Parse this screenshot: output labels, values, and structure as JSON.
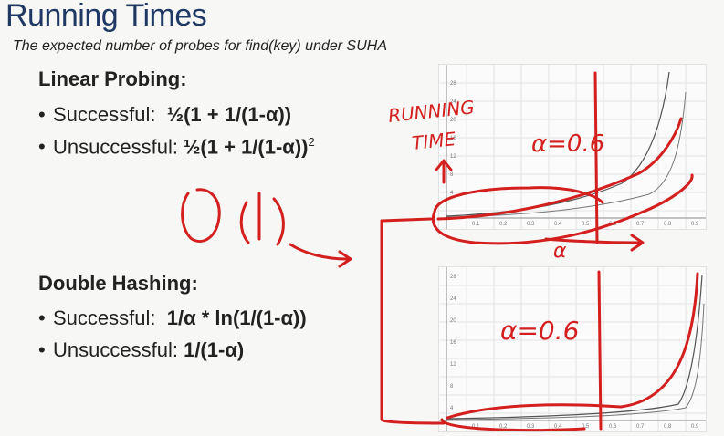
{
  "slide": {
    "title": "Running Times",
    "subtitle": "The expected number of probes for find(key) under SUHA"
  },
  "linear_probing": {
    "heading": "Linear Probing:",
    "successful_label": "Successful:",
    "successful_formula": "½(1 + 1/(1-α))",
    "unsuccessful_label": "Unsuccessful:",
    "unsuccessful_formula": "½(1 + 1/(1-α))",
    "unsuccessful_power": "2"
  },
  "double_hashing": {
    "heading": "Double Hashing:",
    "successful_label": "Successful:",
    "successful_formula": "1/α * ln(1/(1-α))",
    "unsuccessful_label": "Unsuccessful:",
    "unsuccessful_formula": "1/(1-α)"
  },
  "annotations": {
    "big_o": "O(1)",
    "running_time_line1": "RUNNING",
    "running_time_line2": "TIME",
    "alpha_top": "α=0.6",
    "alpha_axis": "α",
    "alpha_bottom": "α=0.6"
  },
  "graph_top": {
    "y_ticks": [
      "28",
      "24",
      "20",
      "16",
      "12",
      "8",
      "4"
    ],
    "x_ticks": [
      "0.1",
      "0.2",
      "0.3",
      "0.4",
      "0.5",
      "0.6",
      "0.7",
      "0.8",
      "0.9"
    ]
  },
  "graph_bottom": {
    "y_ticks": [
      "28",
      "24",
      "20",
      "16",
      "12",
      "8",
      "4"
    ],
    "x_ticks": [
      "0.1",
      "0.2",
      "0.3",
      "0.4",
      "0.5",
      "0.6",
      "0.7",
      "0.8",
      "0.9"
    ]
  },
  "colors": {
    "title": "#1f3864",
    "ink": "#d41f1f",
    "text": "#222222"
  }
}
